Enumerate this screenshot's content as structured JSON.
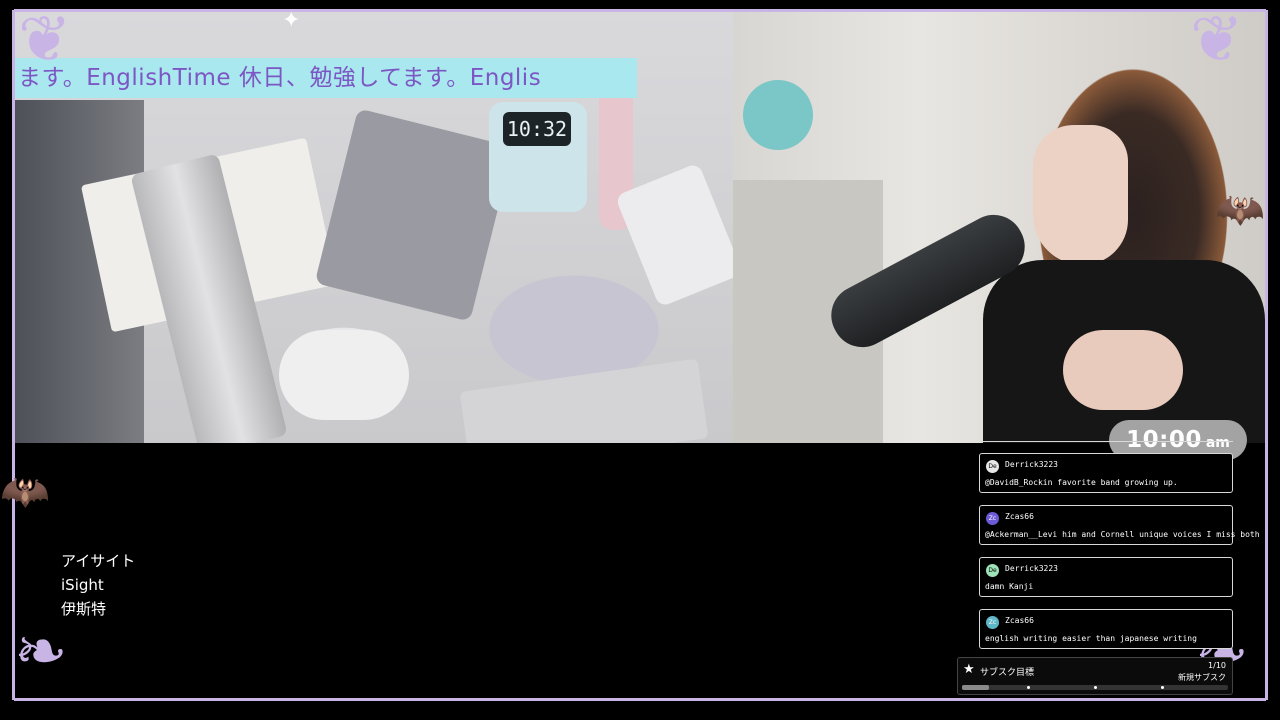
{
  "ticker": {
    "text": "ます。EnglishTime 休日、勉強してます。Englis"
  },
  "desk_cam": {
    "timer_display": "10:32"
  },
  "logo_text": {
    "line1": "アイサイト",
    "line2": "iSight",
    "line3": "伊斯特"
  },
  "clock": {
    "time": "10:00",
    "ampm": "am"
  },
  "chat": {
    "messages": [
      {
        "avatar": "De",
        "user": "Derrick3223",
        "text": "@DavidB_Rockin favorite band growing up."
      },
      {
        "avatar": "Zc",
        "user": "Zcas66",
        "text": "@Ackerman__Levi him and Cornell unique voices I miss both"
      },
      {
        "avatar": "De",
        "user": "Derrick3223",
        "text": "damn Kanji"
      },
      {
        "avatar": "Zc",
        "user": "Zcas66",
        "text": "english writing easier than japanese writing"
      }
    ]
  },
  "sub_goal": {
    "label": "サブスク目標",
    "count": "1/10",
    "sublabel": "新規サブスク",
    "progress": 0.1
  },
  "colors": {
    "frame": "#c9b4e6",
    "ticker_bg": "#a9e8ee",
    "ticker_text": "#7c57c4",
    "clock_bg": "#a3a3a3"
  },
  "icons": {
    "goal": "star-icon",
    "decor": [
      "bat-icon",
      "swirl-icon",
      "sparkle-icon"
    ]
  }
}
